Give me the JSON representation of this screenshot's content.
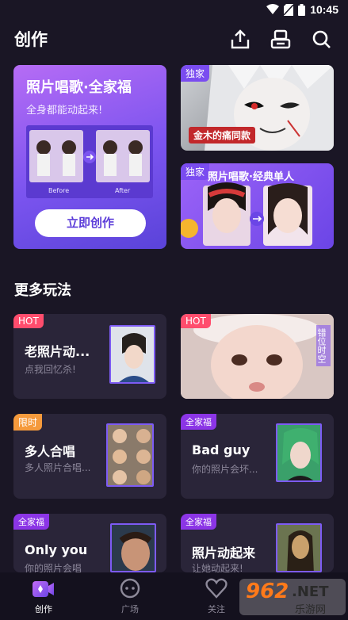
{
  "status": {
    "time": "10:45"
  },
  "header": {
    "title": "创作"
  },
  "featured": {
    "title": "照片唱歌·全家福",
    "subtitle": "全身都能动起来!",
    "before_label": "Before",
    "after_label": "After",
    "cta": "立即创作"
  },
  "promo_cards": [
    {
      "tag": "独家",
      "caption": "金木的痛同款"
    },
    {
      "tag": "独家",
      "caption": "照片唱歌·经典单人"
    }
  ],
  "more": {
    "title": "更多玩法"
  },
  "gameplay_cards": [
    {
      "tag": "HOT",
      "name": "老照片动...",
      "sub": "点我回忆杀!"
    },
    {
      "tag": "HOT",
      "side_text": "错位时空"
    },
    {
      "tag": "限时",
      "name": "多人合唱",
      "sub": "多人照片合唱..."
    },
    {
      "tag": "全家福",
      "name": "Bad guy",
      "sub": "你的照片会坏..."
    },
    {
      "tag": "全家福",
      "name": "Only you",
      "sub": "你的照片会唱"
    },
    {
      "tag": "全家福",
      "name": "照片动起来",
      "sub": "让她动起来!"
    }
  ],
  "nav": {
    "create": "创作",
    "plaza": "广场",
    "follow": "关注"
  },
  "watermark": {
    "number": "962",
    "suffix": ".NET",
    "site": "乐游网"
  }
}
